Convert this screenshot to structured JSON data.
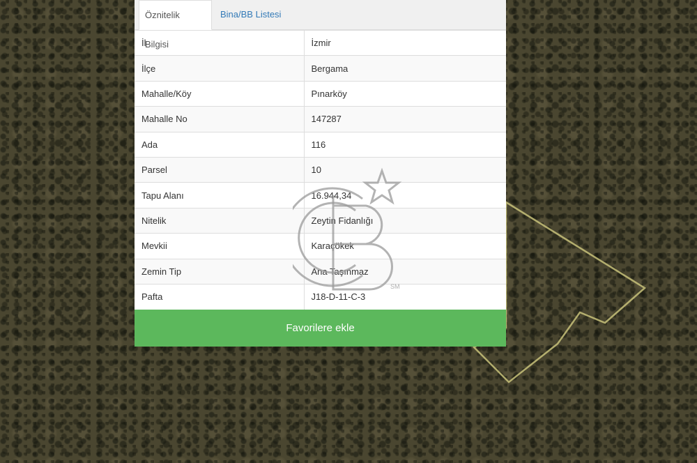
{
  "tabs": {
    "attribute_label": "Öznitelik Bilgisi",
    "building_label": "Bina/BB Listesi"
  },
  "attributes": [
    {
      "key": "İl",
      "value": "İzmir"
    },
    {
      "key": "İlçe",
      "value": "Bergama"
    },
    {
      "key": "Mahalle/Köy",
      "value": "Pınarköy"
    },
    {
      "key": "Mahalle No",
      "value": "147287"
    },
    {
      "key": "Ada",
      "value": "116"
    },
    {
      "key": "Parsel",
      "value": "10"
    },
    {
      "key": "Tapu Alanı",
      "value": "16.944,34"
    },
    {
      "key": "Nitelik",
      "value": "Zeytin Fidanlığı"
    },
    {
      "key": "Mevkii",
      "value": "Karaçökek"
    },
    {
      "key": "Zemin Tip",
      "value": "Ana Taşınmaz"
    },
    {
      "key": "Pafta",
      "value": "J18-D-11-C-3"
    }
  ],
  "favorite_button_label": "Favorilere ekle",
  "watermark": {
    "mark_text": "CB",
    "sub_text": "SM"
  },
  "colors": {
    "accent_green": "#5cb85c",
    "tab_link": "#337ab7",
    "parcel_outline": "#c8c27a"
  }
}
